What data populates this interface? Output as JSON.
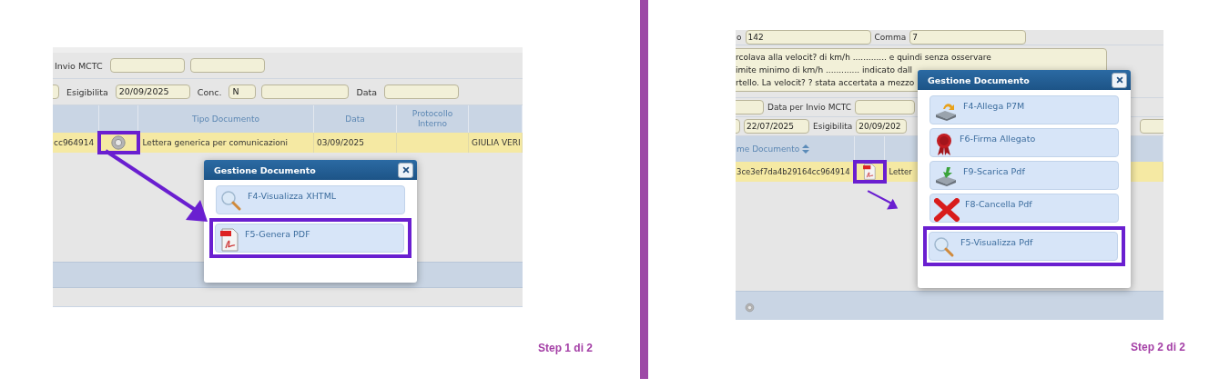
{
  "steps": [
    {
      "form_rows": [
        [
          {
            "kind": "label",
            "text": "Invio MCTC"
          },
          {
            "kind": "field"
          },
          {
            "kind": "field"
          }
        ],
        [
          {
            "kind": "field"
          },
          {
            "kind": "label",
            "text": "Esigibilita"
          },
          {
            "kind": "field",
            "value": "20/09/2025"
          },
          {
            "kind": "label",
            "text": "Conc."
          },
          {
            "kind": "field",
            "value": "N"
          },
          {
            "kind": "field"
          },
          {
            "kind": "label",
            "text": "Data"
          },
          {
            "kind": "field"
          }
        ]
      ],
      "table": {
        "columns": [
          {},
          {},
          {
            "label": "Tipo Documento"
          },
          {
            "label": "Data"
          },
          {
            "label": "Protocollo Interno"
          },
          {}
        ],
        "rows": [
          {
            "selected": true,
            "cells": [
              {
                "kind": "text",
                "text": "cc964914"
              },
              {
                "kind": "gear",
                "highlighted": true
              },
              {
                "kind": "text",
                "text": "Lettera generica per comunicazioni"
              },
              {
                "kind": "text",
                "text": "03/09/2025"
              },
              {
                "kind": "text",
                "text": ""
              },
              {
                "kind": "text",
                "text": "GIULIA VERI"
              }
            ]
          }
        ]
      },
      "popup": {
        "title": "Gestione Documento",
        "items": [
          {
            "label": "F4-Visualizza XHTML",
            "kind": "search",
            "highlighted": false
          },
          {
            "label": "F5-Genera PDF",
            "kind": "pdf",
            "highlighted": true
          }
        ]
      },
      "caption": "Step 1 di 2"
    },
    {
      "form_rows": [
        [
          {
            "kind": "label",
            "text": "o"
          },
          {
            "kind": "field",
            "value": "142"
          },
          {
            "kind": "label",
            "text": "Comma"
          },
          {
            "kind": "field",
            "value": "7"
          }
        ],
        [
          {
            "kind": "textarea",
            "lines": [
              "rcolava alla velocit? di km/h ............. e quindi senza osservare",
              "imite minimo di km/h ............. indicato dall",
              "rtello. La velocit? ? stata accertata a mezzo"
            ]
          }
        ],
        [
          {
            "kind": "field"
          },
          {
            "kind": "label",
            "text": "Data per Invio MCTC"
          },
          {
            "kind": "field"
          }
        ],
        [
          {
            "kind": "field"
          },
          {
            "kind": "field",
            "value": "22/07/2025"
          },
          {
            "kind": "label",
            "text": "Esigibilita"
          },
          {
            "kind": "field",
            "value": "20/09/202"
          },
          {
            "kind": "spacer"
          },
          {
            "kind": "field"
          }
        ]
      ],
      "table": {
        "columns": [
          {
            "label": "me Documento",
            "sortable": true
          },
          {},
          {}
        ],
        "rows": [
          {
            "selected": true,
            "cells": [
              {
                "kind": "text",
                "text": "3ce3ef7da4b29164cc964914"
              },
              {
                "kind": "pdf",
                "highlighted": true
              },
              {
                "kind": "text",
                "text": "Letter"
              }
            ]
          }
        ]
      },
      "footer_bar": {
        "kind": "gear"
      },
      "popup": {
        "title": "Gestione Documento",
        "items": [
          {
            "label": "F4-Allega P7M",
            "kind": "attach",
            "highlighted": false
          },
          {
            "label": "F6-Firma Allegato",
            "kind": "seal",
            "highlighted": false
          },
          {
            "label": "F9-Scarica Pdf",
            "kind": "download",
            "highlighted": false
          },
          {
            "label": "F8-Cancella Pdf",
            "kind": "delete",
            "highlighted": false
          },
          {
            "label": "F5-Visualizza Pdf",
            "kind": "search",
            "highlighted": true
          }
        ]
      },
      "caption": "Step 2 di 2"
    }
  ]
}
